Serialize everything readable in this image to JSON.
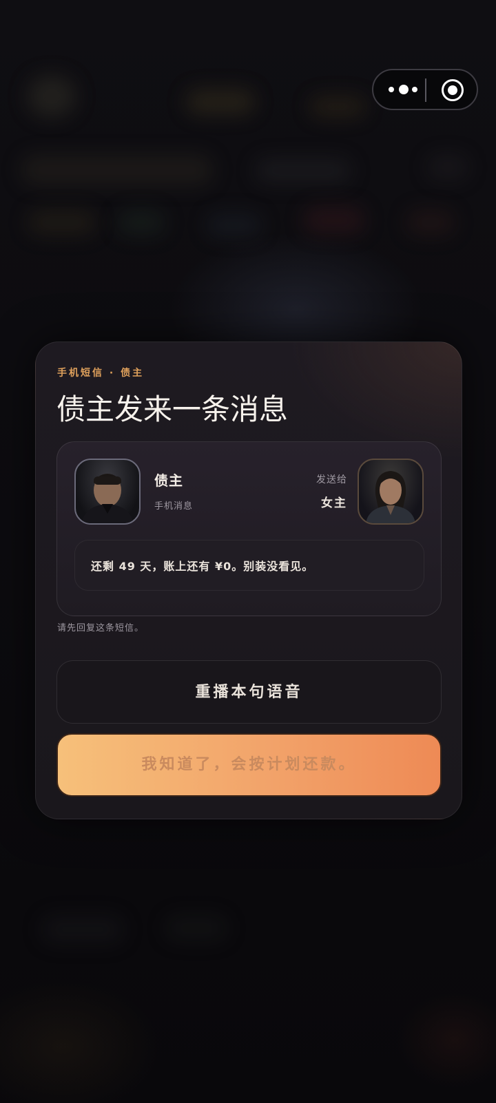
{
  "capsule": {
    "more_icon": "more-dots-icon",
    "close_icon": "target-close-icon"
  },
  "dialog": {
    "kicker": "手机短信 · 债主",
    "title": "债主发来一条消息",
    "sender": {
      "name": "债主",
      "subtitle": "手机消息"
    },
    "recipient": {
      "label": "发送给",
      "name": "女主"
    },
    "message": "还剩 49 天，账上还有 ¥0。别装没看见。",
    "hint": "请先回复这条短信。",
    "replay_button": "重播本句语音",
    "confirm_button": "我知道了，会按计划还款。"
  },
  "colors": {
    "accent": "#e0a15c",
    "confirm_gradient_start": "#f6c07a",
    "confirm_gradient_end": "#ee8a55",
    "card_bg": "#1c181e",
    "page_bg": "#0b0a0d"
  }
}
